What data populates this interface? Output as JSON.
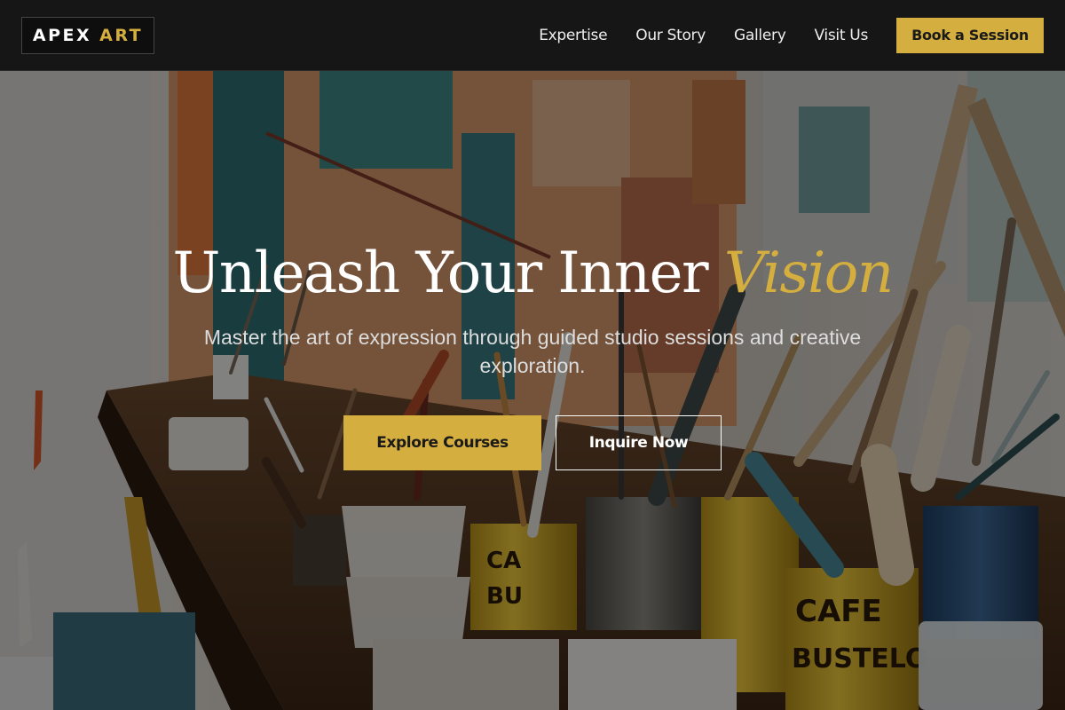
{
  "header": {
    "logo": {
      "word1": "APEX",
      "word2": "ART"
    },
    "nav": [
      {
        "label": "Expertise"
      },
      {
        "label": "Our Story"
      },
      {
        "label": "Gallery"
      },
      {
        "label": "Visit Us"
      }
    ],
    "cta_label": "Book a Session"
  },
  "hero": {
    "headline_main": "Unleash Your Inner",
    "headline_accent": "Vision",
    "subheadline": "Master the art of expression through guided studio sessions and creative exploration.",
    "primary_cta": "Explore Courses",
    "secondary_cta": "Inquire Now",
    "background_image": {
      "can_text_1": "CAFE",
      "can_text_2": "BUSTELO"
    }
  },
  "colors": {
    "accent": "#d4ae3e",
    "header_bg": "#161616",
    "text_light": "#ffffff"
  }
}
